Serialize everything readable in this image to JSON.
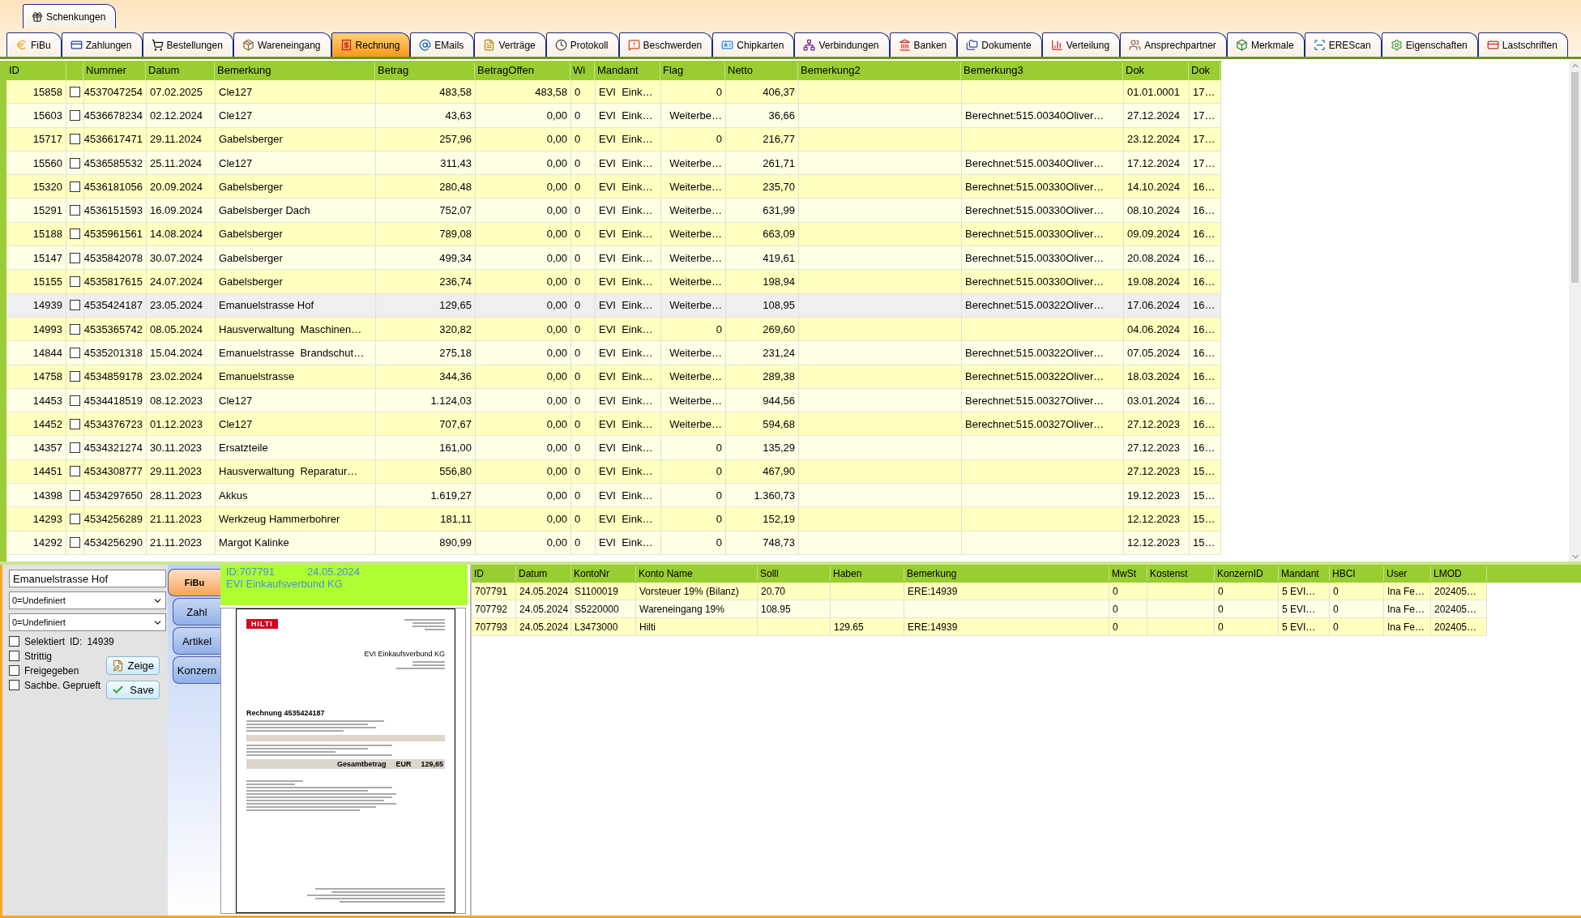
{
  "top_tabs": [
    {
      "label": "Schenkungen",
      "selected": false
    }
  ],
  "tabs": [
    {
      "label": "FiBu",
      "selected": false
    },
    {
      "label": "Zahlungen",
      "selected": false
    },
    {
      "label": "Bestellungen",
      "selected": false
    },
    {
      "label": "Wareneingang",
      "selected": false
    },
    {
      "label": "Rechnung",
      "selected": true
    },
    {
      "label": "EMails",
      "selected": false
    },
    {
      "label": "Verträge",
      "selected": false
    },
    {
      "label": "Protokoll",
      "selected": false
    },
    {
      "label": "Beschwerden",
      "selected": false
    },
    {
      "label": "Chipkarten",
      "selected": false
    },
    {
      "label": "Verbindungen",
      "selected": false
    },
    {
      "label": "Banken",
      "selected": false
    },
    {
      "label": "Dokumente",
      "selected": false
    },
    {
      "label": "Verteilung",
      "selected": false
    },
    {
      "label": "Ansprechpartner",
      "selected": false
    },
    {
      "label": "Merkmale",
      "selected": false
    },
    {
      "label": "EREScan",
      "selected": false
    },
    {
      "label": "Eigenschaften",
      "selected": false
    },
    {
      "label": "Lastschriften",
      "selected": false
    }
  ],
  "table": {
    "columns": [
      "ID",
      "Nummer",
      "Datum",
      "Bemerkung",
      "Betrag",
      "BetragOffen",
      "Wi",
      "Mandant",
      "Flag",
      "Netto",
      "Bemerkung2",
      "Bemerkung3",
      "Dok",
      "Dok"
    ],
    "rows": [
      {
        "selected": false,
        "checked": false,
        "id": "15858",
        "nummer": "4537047254",
        "datum": "07.02.2025",
        "bemerkung": "Cle127",
        "betrag": "483,58",
        "offen": "483,58",
        "wi": "0",
        "mandant": "EVI  Eink…",
        "flag": "0",
        "netto": "406,37",
        "dok": "01.01.0001",
        "dok2": "17…"
      },
      {
        "selected": false,
        "checked": false,
        "id": "15603",
        "nummer": "4536678234",
        "datum": "02.12.2024",
        "bemerkung": "Cle127",
        "betrag": "43,63",
        "offen": "0,00",
        "wi": "0",
        "mandant": "EVI  Eink…",
        "flag": "Weiterbe…",
        "netto": "36,66",
        "bemerkung3": "Berechnet:515.00340Oliver…",
        "dok": "27.12.2024",
        "dok2": "17…"
      },
      {
        "selected": false,
        "checked": false,
        "id": "15717",
        "nummer": "4536617471",
        "datum": "29.11.2024",
        "bemerkung": "Gabelsberger",
        "betrag": "257,96",
        "offen": "0,00",
        "wi": "0",
        "mandant": "EVI  Eink…",
        "flag": "0",
        "netto": "216,77",
        "dok": "23.12.2024",
        "dok2": "17…"
      },
      {
        "selected": false,
        "checked": false,
        "id": "15560",
        "nummer": "4536585532",
        "datum": "25.11.2024",
        "bemerkung": "Cle127",
        "betrag": "311,43",
        "offen": "0,00",
        "wi": "0",
        "mandant": "EVI  Eink…",
        "flag": "Weiterbe…",
        "netto": "261,71",
        "bemerkung3": "Berechnet:515.00340Oliver…",
        "dok": "17.12.2024",
        "dok2": "17…"
      },
      {
        "selected": false,
        "checked": false,
        "id": "15320",
        "nummer": "4536181056",
        "datum": "20.09.2024",
        "bemerkung": "Gabelsberger",
        "betrag": "280,48",
        "offen": "0,00",
        "wi": "0",
        "mandant": "EVI  Eink…",
        "flag": "Weiterbe…",
        "netto": "235,70",
        "bemerkung3": "Berechnet:515.00330Oliver…",
        "dok": "14.10.2024",
        "dok2": "16…"
      },
      {
        "selected": false,
        "checked": false,
        "id": "15291",
        "nummer": "4536151593",
        "datum": "16.09.2024",
        "bemerkung": "Gabelsberger Dach",
        "betrag": "752,07",
        "offen": "0,00",
        "wi": "0",
        "mandant": "EVI  Eink…",
        "flag": "Weiterbe…",
        "netto": "631,99",
        "bemerkung3": "Berechnet:515.00330Oliver…",
        "dok": "08.10.2024",
        "dok2": "16…"
      },
      {
        "selected": false,
        "checked": false,
        "id": "15188",
        "nummer": "4535961561",
        "datum": "14.08.2024",
        "bemerkung": "Gabelsberger",
        "betrag": "789,08",
        "offen": "0,00",
        "wi": "0",
        "mandant": "EVI  Eink…",
        "flag": "Weiterbe…",
        "netto": "663,09",
        "bemerkung3": "Berechnet:515.00330Oliver…",
        "dok": "09.09.2024",
        "dok2": "16…"
      },
      {
        "selected": false,
        "checked": false,
        "id": "15147",
        "nummer": "4535842078",
        "datum": "30.07.2024",
        "bemerkung": "Gabelsberger",
        "betrag": "499,34",
        "offen": "0,00",
        "wi": "0",
        "mandant": "EVI  Eink…",
        "flag": "Weiterbe…",
        "netto": "419,61",
        "bemerkung3": "Berechnet:515.00330Oliver…",
        "dok": "20.08.2024",
        "dok2": "16…"
      },
      {
        "selected": false,
        "checked": false,
        "id": "15155",
        "nummer": "4535817615",
        "datum": "24.07.2024",
        "bemerkung": "Gabelsberger",
        "betrag": "236,74",
        "offen": "0,00",
        "wi": "0",
        "mandant": "EVI  Eink…",
        "flag": "Weiterbe…",
        "netto": "198,94",
        "bemerkung3": "Berechnet:515.00330Oliver…",
        "dok": "19.08.2024",
        "dok2": "16…"
      },
      {
        "selected": true,
        "checked": false,
        "id": "14939",
        "nummer": "4535424187",
        "datum": "23.05.2024",
        "bemerkung": "Emanuelstrasse Hof",
        "betrag": "129,65",
        "offen": "0,00",
        "wi": "0",
        "mandant": "EVI  Eink…",
        "flag": "Weiterbe…",
        "netto": "108,95",
        "bemerkung3": "Berechnet:515.00322Oliver…",
        "dok": "17.06.2024",
        "dok2": "16…"
      },
      {
        "selected": false,
        "checked": false,
        "id": "14993",
        "nummer": "4535365742",
        "datum": "08.05.2024",
        "bemerkung": "Hausverwaltung  Maschinen…",
        "betrag": "320,82",
        "offen": "0,00",
        "wi": "0",
        "mandant": "EVI  Eink…",
        "flag": "0",
        "netto": "269,60",
        "dok": "04.06.2024",
        "dok2": "16…"
      },
      {
        "selected": false,
        "checked": false,
        "id": "14844",
        "nummer": "4535201318",
        "datum": "15.04.2024",
        "bemerkung": "Emanuelstrasse  Brandschut…",
        "betrag": "275,18",
        "offen": "0,00",
        "wi": "0",
        "mandant": "EVI  Eink…",
        "flag": "Weiterbe…",
        "netto": "231,24",
        "bemerkung3": "Berechnet:515.00322Oliver…",
        "dok": "07.05.2024",
        "dok2": "16…"
      },
      {
        "selected": false,
        "checked": false,
        "id": "14758",
        "nummer": "4534859178",
        "datum": "23.02.2024",
        "bemerkung": "Emanuelstrasse",
        "betrag": "344,36",
        "offen": "0,00",
        "wi": "0",
        "mandant": "EVI  Eink…",
        "flag": "Weiterbe…",
        "netto": "289,38",
        "bemerkung3": "Berechnet:515.00322Oliver…",
        "dok": "18.03.2024",
        "dok2": "16…"
      },
      {
        "selected": false,
        "checked": false,
        "id": "14453",
        "nummer": "4534418519",
        "datum": "08.12.2023",
        "bemerkung": "Cle127",
        "betrag": "1.124,03",
        "offen": "0,00",
        "wi": "0",
        "mandant": "EVI  Eink…",
        "flag": "Weiterbe…",
        "netto": "944,56",
        "bemerkung3": "Berechnet:515.00327Oliver…",
        "dok": "03.01.2024",
        "dok2": "16…"
      },
      {
        "selected": false,
        "checked": false,
        "id": "14452",
        "nummer": "4534376723",
        "datum": "01.12.2023",
        "bemerkung": "Cle127",
        "betrag": "707,67",
        "offen": "0,00",
        "wi": "0",
        "mandant": "EVI  Eink…",
        "flag": "Weiterbe…",
        "netto": "594,68",
        "bemerkung3": "Berechnet:515.00327Oliver…",
        "dok": "27.12.2023",
        "dok2": "16…"
      },
      {
        "selected": false,
        "checked": false,
        "id": "14357",
        "nummer": "4534321274",
        "datum": "30.11.2023",
        "bemerkung": "Ersatzteile",
        "betrag": "161,00",
        "offen": "0,00",
        "wi": "0",
        "mandant": "EVI  Eink…",
        "flag": "0",
        "netto": "135,29",
        "dok": "27.12.2023",
        "dok2": "16…"
      },
      {
        "selected": false,
        "checked": false,
        "id": "14451",
        "nummer": "4534308777",
        "datum": "29.11.2023",
        "bemerkung": "Hausverwaltung  Reparatur…",
        "betrag": "556,80",
        "offen": "0,00",
        "wi": "0",
        "mandant": "EVI  Eink…",
        "flag": "0",
        "netto": "467,90",
        "dok": "27.12.2023",
        "dok2": "15…"
      },
      {
        "selected": false,
        "checked": false,
        "id": "14398",
        "nummer": "4534297650",
        "datum": "28.11.2023",
        "bemerkung": "Akkus",
        "betrag": "1.619,27",
        "offen": "0,00",
        "wi": "0",
        "mandant": "EVI  Eink…",
        "flag": "0",
        "netto": "1.360,73",
        "dok": "19.12.2023",
        "dok2": "15…"
      },
      {
        "selected": false,
        "checked": false,
        "id": "14293",
        "nummer": "4534256289",
        "datum": "21.11.2023",
        "bemerkung": "Werkzeug Hammerbohrer",
        "betrag": "181,11",
        "offen": "0,00",
        "wi": "0",
        "mandant": "EVI  Eink…",
        "flag": "0",
        "netto": "152,19",
        "dok": "12.12.2023",
        "dok2": "15…"
      },
      {
        "selected": false,
        "checked": false,
        "id": "14292",
        "nummer": "4534256290",
        "datum": "21.11.2023",
        "bemerkung": "Margot Kalinke",
        "betrag": "890,99",
        "offen": "0,00",
        "wi": "0",
        "mandant": "EVI  Eink…",
        "flag": "0",
        "netto": "748,73",
        "dok": "12.12.2023",
        "dok2": "15…"
      }
    ]
  },
  "detail": {
    "name_field": {
      "value": "Emanuelstrasse Hof"
    },
    "selects": [
      {
        "value": "0=Undefiniert"
      },
      {
        "value": "0=Undefiniert"
      }
    ],
    "checkboxes": [
      {
        "label": "Selektiert",
        "checked": false
      },
      {
        "label": "Strittig",
        "checked": false
      },
      {
        "label": "Freigegeben",
        "checked": false
      },
      {
        "label": "Sachbe. Geprueft",
        "checked": false
      }
    ],
    "id_label": "ID:",
    "id_value": "14939",
    "buttons": [
      {
        "label": "Zeige",
        "kind": "edit"
      },
      {
        "label": "Save",
        "kind": "save"
      }
    ]
  },
  "side_tabs": [
    {
      "label": "FiBu",
      "selected": true
    },
    {
      "label": "Zahl",
      "selected": false
    },
    {
      "label": "Artikel",
      "selected": false
    },
    {
      "label": "Konzern",
      "selected": false
    }
  ],
  "preview": {
    "header_id": "ID:707791",
    "header_date": "24.05.2024",
    "header_company": "EVI Einkaufsverbund KG",
    "document": {
      "logo": "HILTI",
      "title": "Rechnung  4535424187",
      "recipient": "EVI Einkaufsverbund KG",
      "total_label": "Gesamtbetrag",
      "currency": "EUR",
      "total": "129,65"
    }
  },
  "bookings": {
    "columns": [
      "ID",
      "Datum",
      "KontoNr",
      "Konto Name",
      "Solll",
      "Haben",
      "Bemerkung",
      "MwSt",
      "Kostenst",
      "KonzernID",
      "Mandant",
      "HBCI",
      "User",
      "LMOD"
    ],
    "rows": [
      {
        "id": "707791",
        "datum": "24.05.2024",
        "konto": "S1100019",
        "name": "Vorsteuer 19% (Bilanz)",
        "soll": "20.70",
        "bem": "ERE:14939",
        "mwst": "0",
        "konzern": "0",
        "mandant": "5 EVI…",
        "hbci": "0",
        "user": "Ina Fe…",
        "lmod": "202405…"
      },
      {
        "id": "707792",
        "datum": "24.05.2024",
        "konto": "S5220000",
        "name": "Wareneingang 19%",
        "soll": "108.95",
        "mwst": "0",
        "konzern": "0",
        "mandant": "5 EVI…",
        "hbci": "0",
        "user": "Ina Fe…",
        "lmod": "202405…"
      },
      {
        "id": "707793",
        "datum": "24.05.2024",
        "konto": "L3473000",
        "name": "Hilti",
        "haben": "129.65",
        "bem": "ERE:14939",
        "mwst": "0",
        "konzern": "0",
        "mandant": "5 EVI…",
        "hbci": "0",
        "user": "Ina Fe…",
        "lmod": "202405…"
      }
    ]
  }
}
